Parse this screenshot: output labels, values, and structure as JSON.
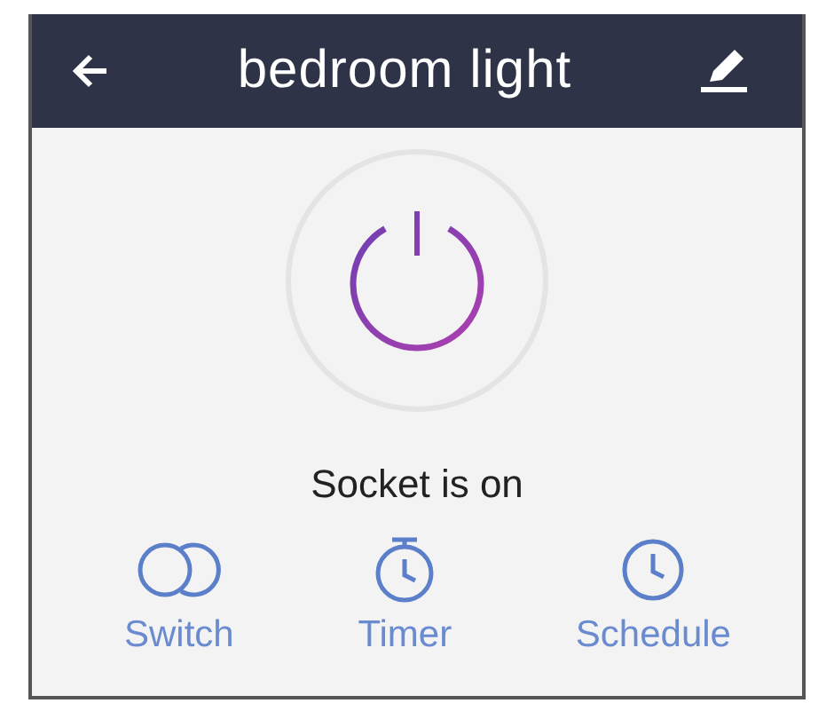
{
  "header": {
    "title": "bedroom light"
  },
  "power": {
    "on": true,
    "status": "Socket is on"
  },
  "actions": [
    {
      "kind": "switch",
      "label": "Switch"
    },
    {
      "kind": "timer",
      "label": "Timer"
    },
    {
      "kind": "schedule",
      "label": "Schedule"
    }
  ]
}
